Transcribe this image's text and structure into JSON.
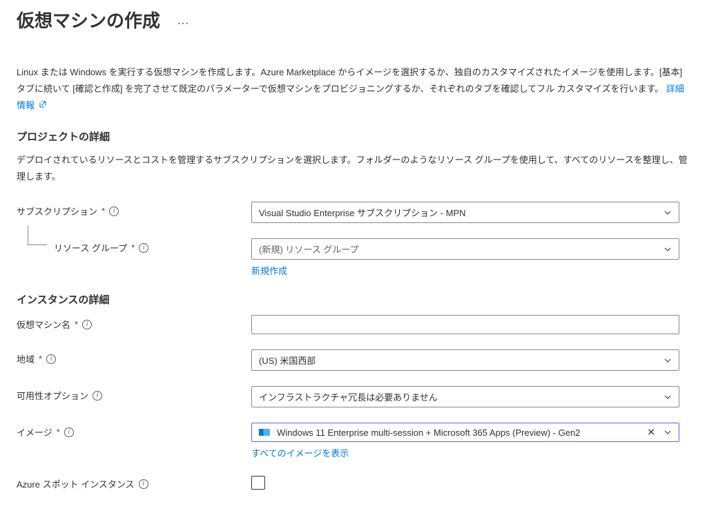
{
  "header": {
    "title": "仮想マシンの作成",
    "more_menu": "…"
  },
  "intro": {
    "text": "Linux または Windows を実行する仮想マシンを作成します。Azure Marketplace からイメージを選択するか、独自のカスタマイズされたイメージを使用します。[基本] タブに続いて [確認と作成] を完了させて既定のパラメーターで仮想マシンをプロビジョニングするか、それぞれのタブを確認してフル カスタマイズを行います。",
    "link_label": "詳細情報"
  },
  "sections": {
    "project": {
      "heading": "プロジェクトの詳細",
      "desc": "デプロイされているリソースとコストを管理するサブスクリプションを選択します。フォルダーのようなリソース グループを使用して、すべてのリソースを整理し、管理します。",
      "subscription_label": "サブスクリプション",
      "subscription_value": "Visual Studio Enterprise サブスクリプション - MPN",
      "resource_group_label": "リソース グループ",
      "resource_group_placeholder": "(新規) リソース グループ",
      "new_link": "新規作成"
    },
    "instance": {
      "heading": "インスタンスの詳細",
      "vm_name_label": "仮想マシン名",
      "region_label": "地域",
      "region_value": "(US) 米国西部",
      "availability_label": "可用性オプション",
      "availability_value": "インフラストラクチャ冗長は必要ありません",
      "image_label": "イメージ",
      "image_value": "Windows 11 Enterprise multi-session + Microsoft 365 Apps (Preview) - Gen2",
      "all_images_link": "すべてのイメージを表示",
      "spot_label": "Azure スポット インスタンス"
    }
  }
}
